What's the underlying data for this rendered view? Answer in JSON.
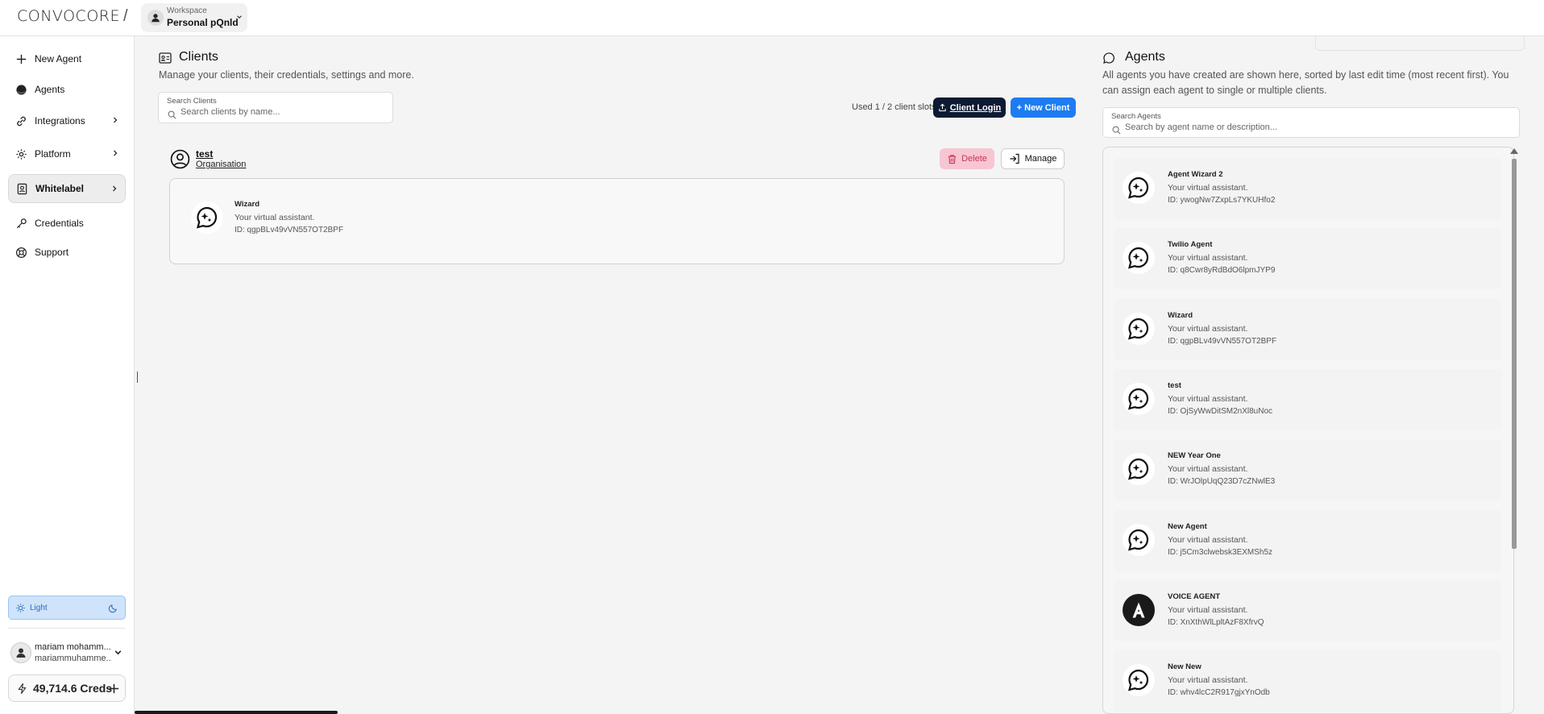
{
  "header": {
    "logo_text": "CONVOCORE",
    "separator": "/",
    "workspace_label": "Workspace",
    "workspace_name": "Personal pQnld"
  },
  "sidebar": {
    "items": [
      {
        "label": "New Agent",
        "icon": "plus-icon"
      },
      {
        "label": "Agents",
        "icon": "agent-dot-icon"
      },
      {
        "label": "Integrations",
        "icon": "link-icon"
      },
      {
        "label": "Platform",
        "icon": "gear-icon"
      },
      {
        "label": "Whitelabel",
        "icon": "id-badge-icon"
      },
      {
        "label": "Credentials",
        "icon": "key-icon"
      },
      {
        "label": "Support",
        "icon": "lifebuoy-icon"
      }
    ],
    "theme_label": "Light",
    "user_name": "mariam mohamm...",
    "user_email": "mariammuhamme...",
    "credits": "49,714.6 Creds"
  },
  "clients": {
    "title": "Clients",
    "description": "Manage your clients, their credentials, settings and more.",
    "search_label": "Search Clients",
    "search_placeholder": "Search clients by name...",
    "slots_text": "Used 1 / 2 client slots",
    "client_login_label": "Client Login",
    "new_client_label": "+ New Client",
    "list": [
      {
        "name": "test",
        "type": "Organisation",
        "delete_label": "Delete",
        "manage_label": "Manage",
        "agents": [
          {
            "name": "Wizard",
            "desc": "Your virtual assistant.",
            "id": "ID: qgpBLv49vVN557OT2BPF"
          }
        ]
      }
    ]
  },
  "agents": {
    "title": "Agents",
    "description": "All agents you have created are shown here, sorted by last edit time (most recent first). You can assign each agent to single or multiple clients.",
    "search_label": "Search Agents",
    "search_placeholder": "Search by agent name or description...",
    "list": [
      {
        "name": "Agent Wizard 2",
        "desc": "Your virtual assistant.",
        "id": "ID: ywogNw7ZxpLs7YKUHfo2",
        "icon": "sparkle-chat-icon"
      },
      {
        "name": "Twilio Agent",
        "desc": "Your virtual assistant.",
        "id": "ID: q8Cwr8yRdBdO6lpmJYP9",
        "icon": "sparkle-chat-icon"
      },
      {
        "name": "Wizard",
        "desc": "Your virtual assistant.",
        "id": "ID: qgpBLv49vVN557OT2BPF",
        "icon": "sparkle-chat-icon"
      },
      {
        "name": "test",
        "desc": "Your virtual assistant.",
        "id": "ID: OjSyWwDitSM2nXl8uNoc",
        "icon": "sparkle-chat-icon"
      },
      {
        "name": "NEW Year One",
        "desc": "Your virtual assistant.",
        "id": "ID: WrJOlpUqQ23D7cZNwlE3",
        "icon": "sparkle-chat-icon"
      },
      {
        "name": "New Agent",
        "desc": "Your virtual assistant.",
        "id": "ID: j5Cm3clwebsk3EXMSh5z",
        "icon": "sparkle-chat-icon"
      },
      {
        "name": "VOICE AGENT",
        "desc": "Your virtual assistant.",
        "id": "ID: XnXthWlLpltAzF8XfrvQ",
        "icon": "anthropic-logo-icon"
      },
      {
        "name": "New New",
        "desc": "Your virtual assistant.",
        "id": "ID: whv4lcC2R917gjxYnOdb",
        "icon": "sparkle-chat-icon"
      }
    ]
  }
}
